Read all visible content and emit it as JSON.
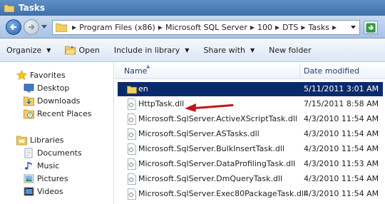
{
  "window": {
    "title": "Tasks"
  },
  "address": {
    "crumbs": [
      "Program Files (x86)",
      "Microsoft SQL Server",
      "100",
      "DTS",
      "Tasks"
    ]
  },
  "toolbar": {
    "organize": "Organize",
    "open": "Open",
    "include_in_library": "Include in library",
    "share_with": "Share with",
    "new_folder": "New folder"
  },
  "nav": {
    "favorites": "Favorites",
    "desktop": "Desktop",
    "downloads": "Downloads",
    "recent_places": "Recent Places",
    "libraries": "Libraries",
    "documents": "Documents",
    "music": "Music",
    "pictures": "Pictures",
    "videos": "Videos"
  },
  "columns": {
    "name": "Name",
    "date_modified": "Date modified"
  },
  "files": [
    {
      "name": "en",
      "date": "5/11/2011 3:01 AM",
      "type": "folder",
      "selected": true
    },
    {
      "name": "HttpTask.dll",
      "date": "7/15/2011 8:58 AM",
      "type": "dll"
    },
    {
      "name": "Microsoft.SqlServer.ActiveXScriptTask.dll",
      "date": "4/3/2010 11:54 AM",
      "type": "dll"
    },
    {
      "name": "Microsoft.SqlServer.ASTasks.dll",
      "date": "4/3/2010 11:54 AM",
      "type": "dll"
    },
    {
      "name": "Microsoft.SqlServer.BulkInsertTask.dll",
      "date": "4/3/2010 11:54 AM",
      "type": "dll"
    },
    {
      "name": "Microsoft.SqlServer.DataProfilingTask.dll",
      "date": "4/3/2010 11:53 AM",
      "type": "dll"
    },
    {
      "name": "Microsoft.SqlServer.DmQueryTask.dll",
      "date": "4/3/2010 11:54 AM",
      "type": "dll"
    },
    {
      "name": "Microsoft.SqlServer.Exec80PackageTask.dll",
      "date": "4/3/2010 11:54 AM",
      "type": "dll"
    }
  ],
  "annotation": {
    "icon": "red-arrow-icon",
    "color": "#c0161b",
    "points_to": "HttpTask.dll"
  },
  "colors": {
    "selection": "#0a2b6b",
    "title_bar": "#4a7bb7"
  }
}
